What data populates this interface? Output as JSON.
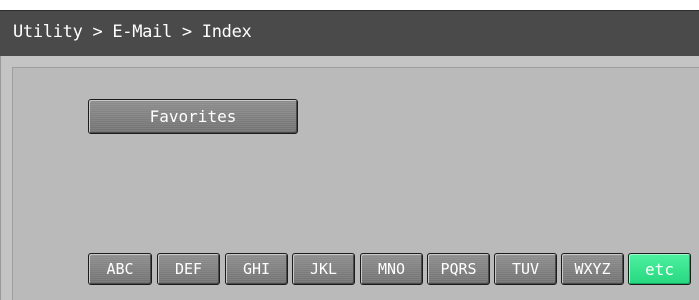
{
  "header": {
    "breadcrumb": "Utility > E-Mail > Index"
  },
  "main": {
    "favorites_label": "Favorites",
    "index_tabs": [
      {
        "label": "ABC",
        "selected": false
      },
      {
        "label": "DEF",
        "selected": false
      },
      {
        "label": "GHI",
        "selected": false
      },
      {
        "label": "JKL",
        "selected": false
      },
      {
        "label": "MNO",
        "selected": false
      },
      {
        "label": "PQRS",
        "selected": false
      },
      {
        "label": "TUV",
        "selected": false
      },
      {
        "label": "WXYZ",
        "selected": false
      },
      {
        "label": "etc",
        "selected": true
      }
    ]
  },
  "colors": {
    "titlebar": "#4a4a4a",
    "panel": "#bababa",
    "button": "#7d7d7d",
    "selected_tab": "#33e08a"
  }
}
